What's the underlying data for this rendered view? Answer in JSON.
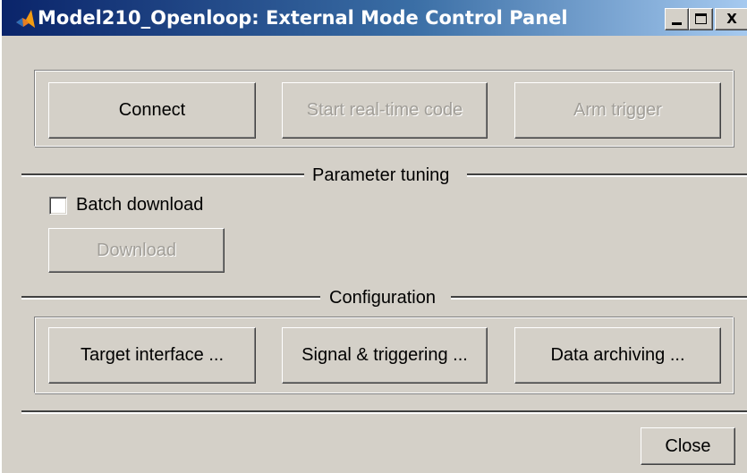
{
  "window": {
    "title": "Model210_Openloop: External Mode Control Panel",
    "icon": "matlab-icon"
  },
  "titlebar_buttons": {
    "minimize": "minimize",
    "maximize": "maximize",
    "close": "X"
  },
  "actions": {
    "connect": "Connect",
    "start_realtime": "Start real-time code",
    "arm_trigger": "Arm trigger",
    "start_realtime_enabled": false,
    "arm_trigger_enabled": false
  },
  "parameter_tuning": {
    "label": "Parameter tuning",
    "batch_download_label": "Batch download",
    "batch_download_checked": false,
    "download_label": "Download",
    "download_enabled": false
  },
  "configuration": {
    "label": "Configuration",
    "target_interface": "Target interface ...",
    "signal_triggering": "Signal & triggering ...",
    "data_archiving": "Data archiving ..."
  },
  "footer": {
    "close_label": "Close"
  }
}
